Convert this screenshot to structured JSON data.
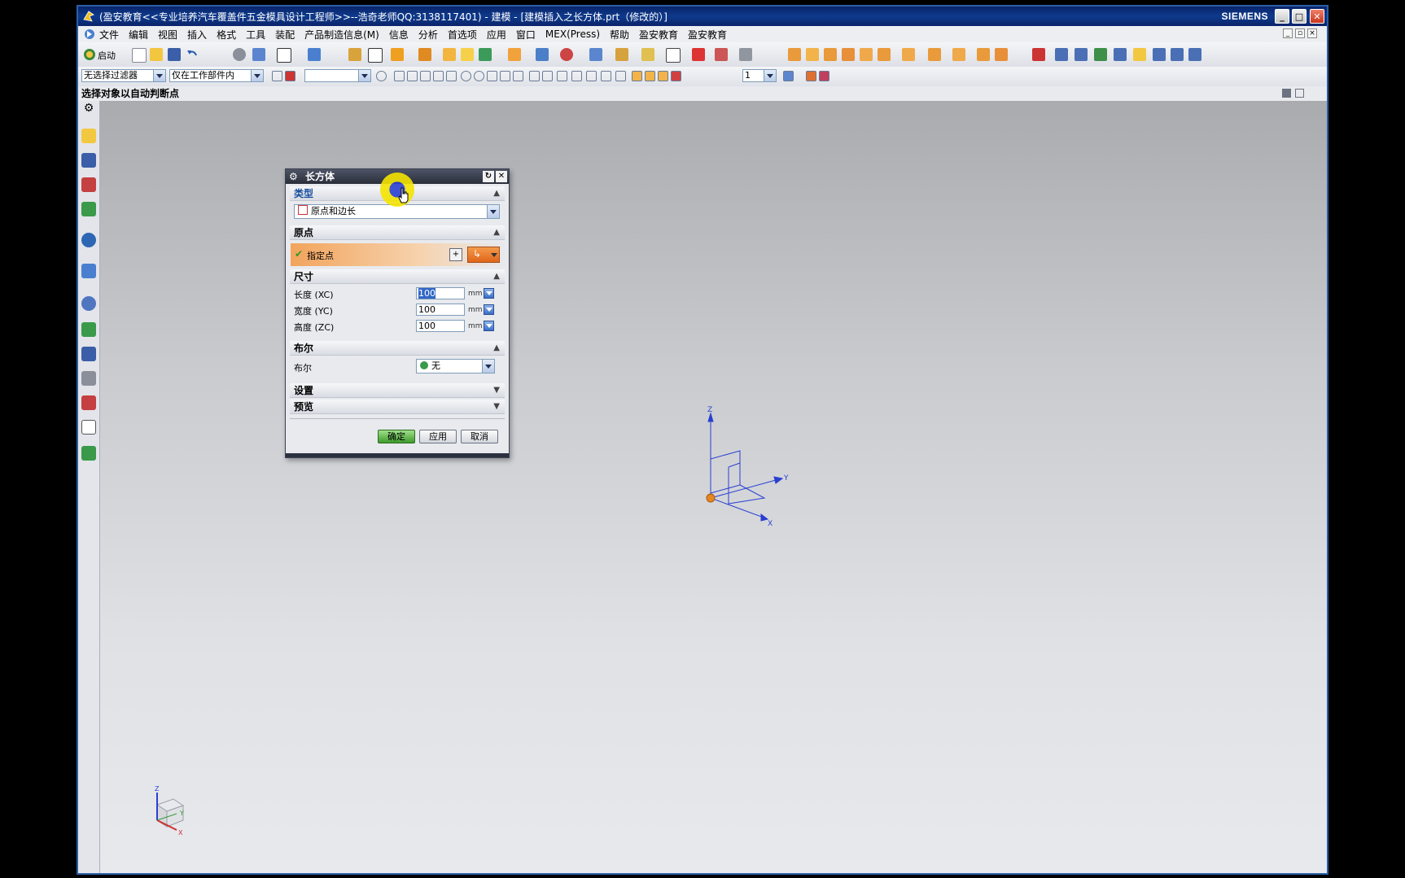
{
  "window": {
    "title": "(盈安教育<<专业培养汽车覆盖件五金模具设计工程师>>--浩奇老师QQ:3138117401) - 建模 - [建模插入之长方体.prt（修改的）]",
    "brand": "SIEMENS"
  },
  "menu": [
    "文件",
    "编辑",
    "视图",
    "插入",
    "格式",
    "工具",
    "装配",
    "产品制造信息(M)",
    "信息",
    "分析",
    "首选项",
    "应用",
    "窗口",
    "MEX(Press)",
    "帮助",
    "盈安教育",
    "盈安教育"
  ],
  "toolbar": {
    "start_label": "启动"
  },
  "filters": {
    "type_filter": "无选择过滤器",
    "scope_filter": "仅在工作部件内",
    "layer_value": "1"
  },
  "cue_line": "选择对象以自动判断点",
  "dialog": {
    "title": "长方体",
    "sections": {
      "type": "类型",
      "origin": "原点",
      "dimensions": "尺寸",
      "boolean": "布尔",
      "settings": "设置",
      "preview": "预览"
    },
    "type_value": "原点和边长",
    "specify_point": "指定点",
    "length_label": "长度 (XC)",
    "width_label": "宽度 (YC)",
    "height_label": "高度 (ZC)",
    "length_value": "100",
    "width_value": "100",
    "height_value": "100",
    "unit": "mm",
    "boolean_label": "布尔",
    "boolean_value": "无",
    "ok": "确定",
    "apply": "应用",
    "cancel": "取消"
  },
  "axes": {
    "x": "X",
    "y": "Y",
    "z": "Z"
  }
}
